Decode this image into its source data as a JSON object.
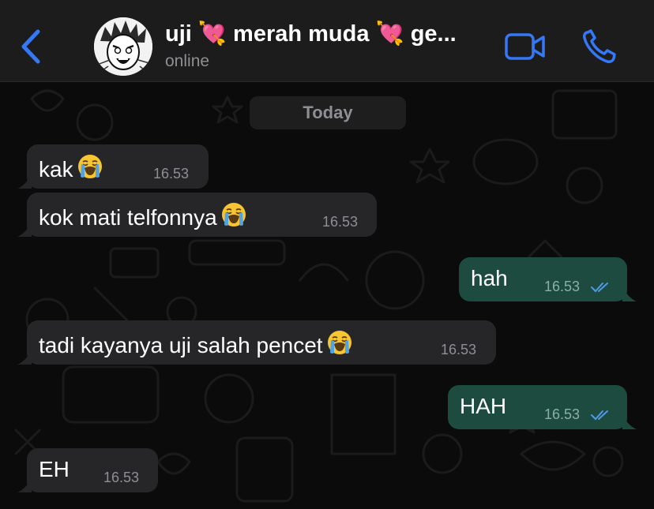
{
  "header": {
    "title": "uji 💘 merah muda 💘 ge...",
    "status": "online",
    "accent_color": "#3478f6",
    "icons": [
      "chevron-left-icon",
      "avatar",
      "video-camera-icon",
      "phone-icon"
    ]
  },
  "chat": {
    "date_label": "Today",
    "messages": [
      {
        "direction": "in",
        "text": "kak",
        "emoji": "loudly-crying-face",
        "time": "16.53"
      },
      {
        "direction": "in",
        "text": "kok mati telfonnya",
        "emoji": "loudly-crying-face",
        "time": "16.53"
      },
      {
        "direction": "out",
        "text": "hah",
        "time": "16.53",
        "status": "read"
      },
      {
        "direction": "in",
        "text": "tadi kayanya uji salah pencet",
        "emoji": "loudly-crying-face",
        "time": "16.53"
      },
      {
        "direction": "out",
        "text": "HAH",
        "time": "16.53",
        "status": "read"
      },
      {
        "direction": "in",
        "text": "EH",
        "time": "16.53"
      }
    ]
  },
  "colors": {
    "incoming_bubble": "#262628",
    "outgoing_bubble": "#1d4b3f",
    "read_ticks": "#4f9ae8",
    "background": "#0b0b0b"
  }
}
